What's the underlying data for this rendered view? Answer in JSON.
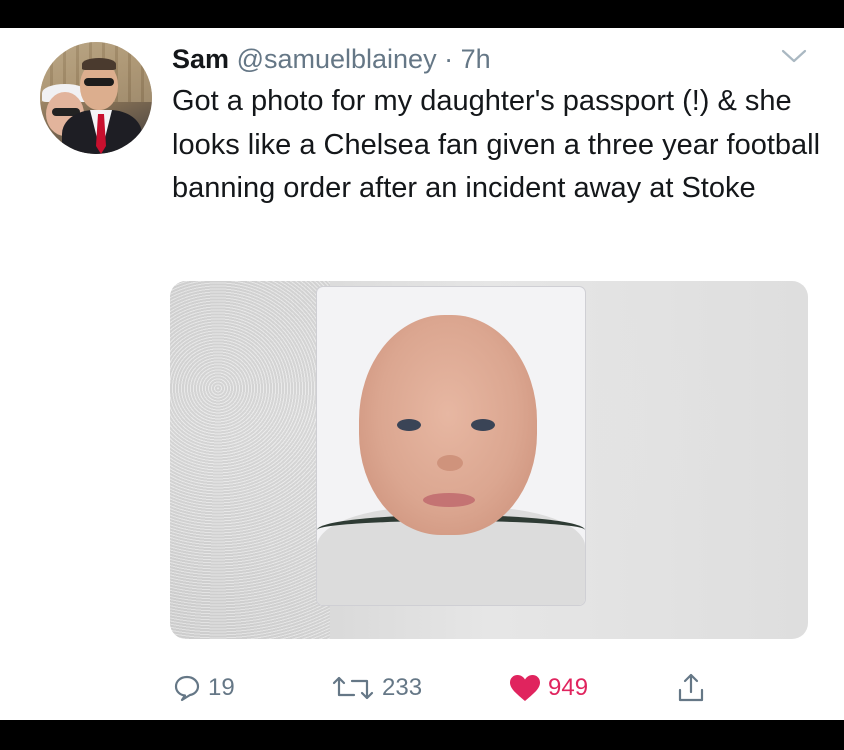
{
  "tweet": {
    "name": "Sam",
    "handle": "@samuelblainey",
    "separator": "·",
    "time": "7h",
    "text": "Got a photo for my daughter's passport (!) & she looks like a Chelsea fan given a three year football banning order after an incident away at Stoke"
  },
  "actions": {
    "replies": "19",
    "retweets": "233",
    "likes": "949"
  },
  "icons": {
    "menu": "chevron-down-icon",
    "reply": "speech-bubble-icon",
    "retweet": "retweet-arrows-icon",
    "like": "heart-icon",
    "share": "share-upload-icon"
  },
  "colors": {
    "like": "#e0245e",
    "secondary_text": "#657786",
    "primary_text": "#14171a"
  }
}
